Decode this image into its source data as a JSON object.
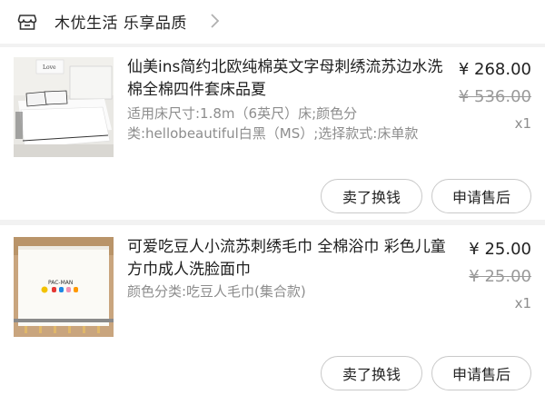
{
  "shop": {
    "name": "木优生活 乐享品质",
    "icon": "shop-icon",
    "chevron": "chevron-right-icon"
  },
  "items": [
    {
      "title": "仙美ins简约北欧纯棉英文字母刺绣流苏边水洗棉全棉四件套床品夏",
      "spec": "适用床尺寸:1.8m（6英尺）床;颜色分类:hellobeautiful白黑（MS）;选择款式:床单款",
      "price": "¥ 268.00",
      "original_price": "¥ 536.00",
      "quantity": "x1",
      "buttons": {
        "exchange": "卖了换钱",
        "after_sale": "申请售后"
      },
      "image": "bedding-set-photo"
    },
    {
      "title": "可爱吃豆人小流苏刺绣毛巾 全棉浴巾 彩色儿童方巾成人洗脸面巾",
      "spec": "颜色分类:吃豆人毛巾(集合款)",
      "price": "¥ 25.00",
      "original_price": "¥ 25.00",
      "quantity": "x1",
      "buttons": {
        "exchange": "卖了换钱",
        "after_sale": "申请售后"
      },
      "image": "pacman-towel-photo"
    }
  ],
  "colors": {
    "background": "#f2f2f2",
    "card": "#ffffff",
    "text": "#222222",
    "muted": "#8d8d8d",
    "border": "#c9c9c9"
  }
}
